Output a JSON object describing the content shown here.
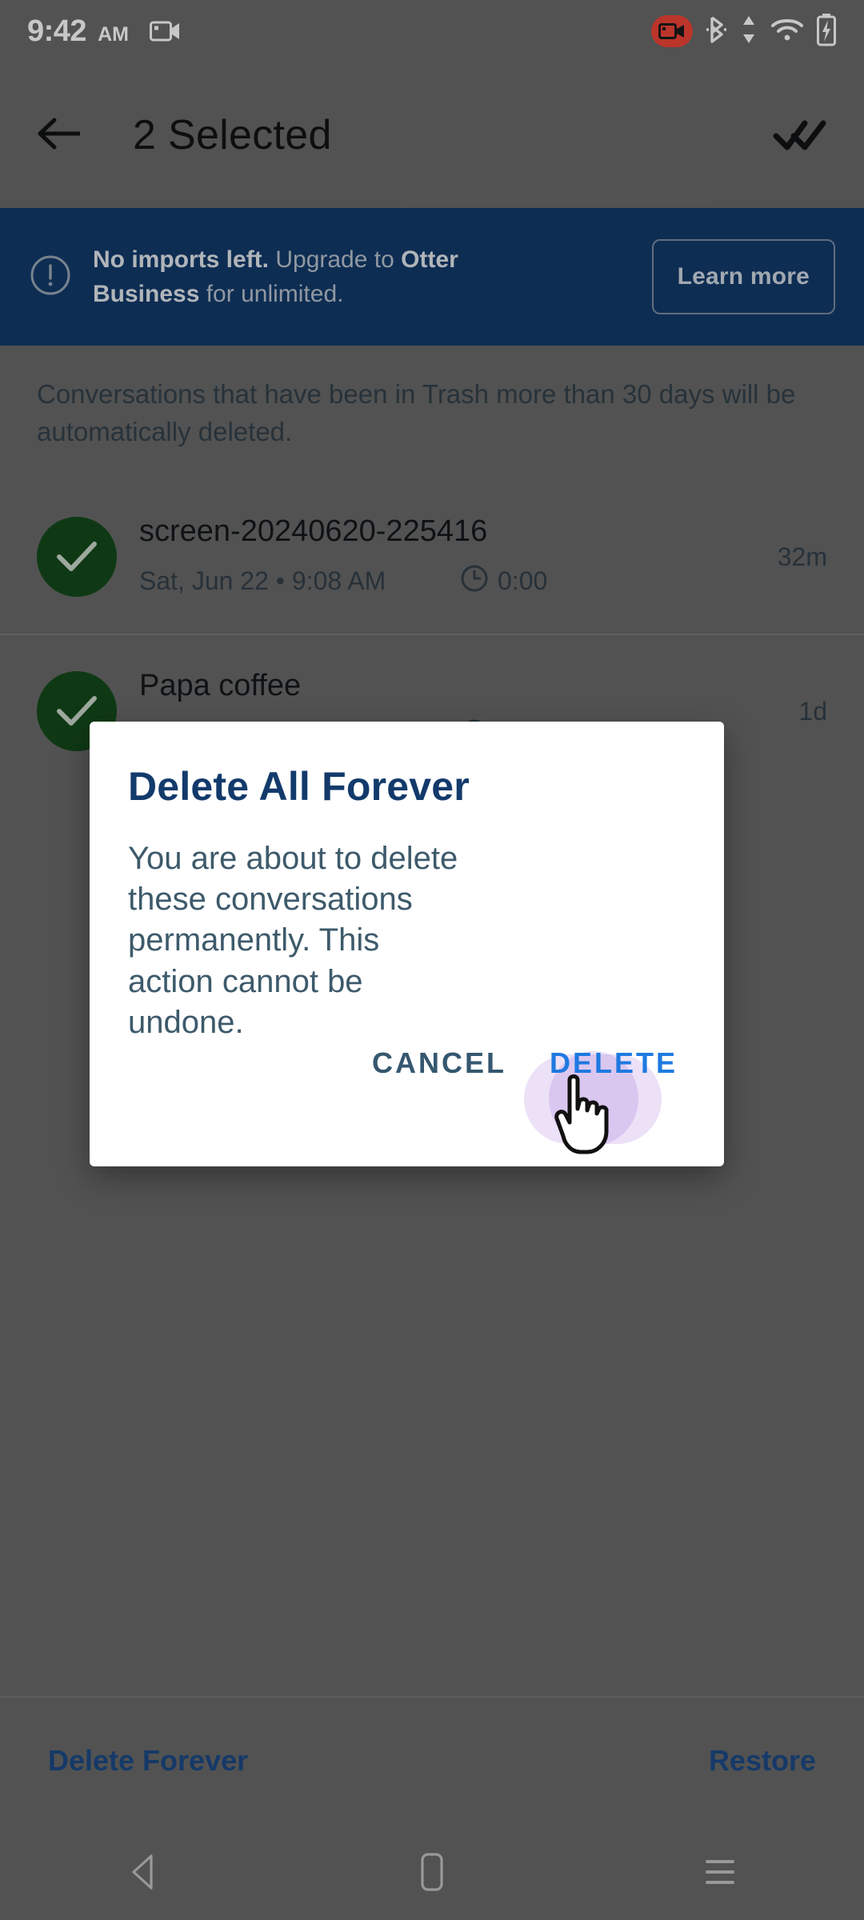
{
  "status_bar": {
    "time": "9:42",
    "ampm": "AM",
    "icons": [
      "screen-record-icon",
      "recording-badge-icon",
      "bluetooth-icon",
      "data-transfer-icon",
      "wifi-icon",
      "battery-charging-icon"
    ]
  },
  "app_bar": {
    "back_icon": "arrow-back-icon",
    "title": "2 Selected",
    "action_icon": "select-all-double-check-icon"
  },
  "banner": {
    "icon": "alert-circle-icon",
    "text_bold_1": "No imports left.",
    "text_normal_1": " Upgrade to ",
    "text_bold_2": "Otter Business",
    "text_normal_2": " for unlimited.",
    "button_label": "Learn more"
  },
  "trash_notice": "Conversations that have been in Trash more than 30 days will be automatically deleted.",
  "conversations": [
    {
      "selected": true,
      "title": "screen-20240620-225416",
      "date": "Sat, Jun 22 • 9:08 AM",
      "duration": "0:00",
      "age": "32m",
      "duration_icon": "clock-icon",
      "check_icon": "check-icon"
    },
    {
      "selected": true,
      "title": "Papa coffee",
      "date": "",
      "duration": "",
      "age": "1d",
      "duration_icon": "clock-icon",
      "check_icon": "check-icon"
    }
  ],
  "bottom_bar": {
    "delete_label": "Delete Forever",
    "restore_label": "Restore"
  },
  "dialog": {
    "title": "Delete All Forever",
    "body": "You are about to delete these conversations permanently. This action cannot be undone.",
    "cancel_label": "CANCEL",
    "delete_label": "DELETE"
  },
  "nav_bar": {
    "back_icon": "nav-back-triangle-icon",
    "home_icon": "nav-home-square-icon",
    "recents_icon": "nav-recents-menu-icon"
  },
  "colors": {
    "scrim": "#6a6a6a",
    "banner_bg": "#123a6b",
    "accent_blue": "#1b4a86",
    "delete_blue": "#1f7ae0",
    "check_green": "#14491a",
    "recording_red": "#f04438"
  }
}
